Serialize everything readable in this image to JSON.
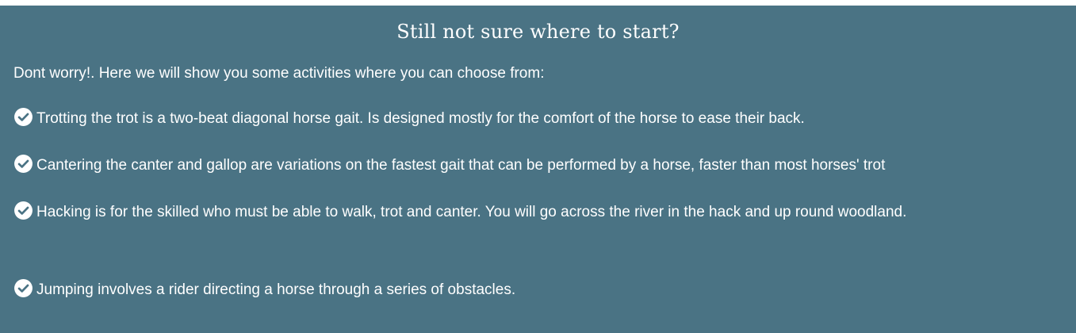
{
  "section": {
    "title": "Still not sure where to start?",
    "intro": "Dont worry!. Here we will show you some activities where you can choose from:",
    "activities": [
      {
        "name": "Trotting",
        "description": " the trot is a two-beat diagonal horse gait. Is designed mostly for the comfort of the horse to ease their back.",
        "icon": "check-circle-icon"
      },
      {
        "name": "Cantering",
        "description": " the canter and gallop are variations on the fastest gait that can be performed by a horse, faster than most horses' trot",
        "icon": "check-circle-icon"
      },
      {
        "name": "Hacking",
        "description": " is for the skilled who must be able to walk, trot and canter. You will go across the river in the hack and up round woodland.",
        "icon": "check-circle-icon"
      },
      {
        "name": "Jumping",
        "description": " involves a rider directing a horse through a series of obstacles.",
        "icon": "check-circle-icon"
      }
    ]
  },
  "colors": {
    "background": "#4a7384",
    "text": "#ffffff"
  }
}
